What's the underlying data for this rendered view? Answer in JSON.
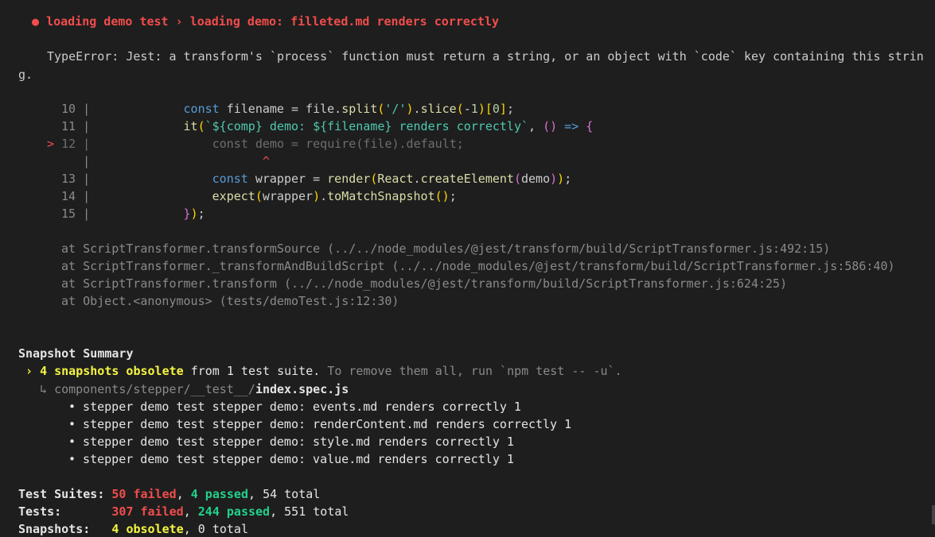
{
  "fail_header": {
    "bullet": "●",
    "suite": "loading demo test",
    "sep": "›",
    "name": "loading demo: filleted.md renders correctly"
  },
  "error": {
    "line1": "TypeError: Jest: a transform's `process` function must return a string, or an object with `code` key containing this strin",
    "line2": "g."
  },
  "code": {
    "l10_num": "10",
    "l11_num": "11",
    "l12_num": "12",
    "l13_num": "13",
    "l14_num": "14",
    "l15_num": "15",
    "pipe": "|",
    "arrow": ">",
    "caret": "^"
  },
  "stack": [
    "at ScriptTransformer.transformSource (../../node_modules/@jest/transform/build/ScriptTransformer.js:492:15)",
    "at ScriptTransformer._transformAndBuildScript (../../node_modules/@jest/transform/build/ScriptTransformer.js:586:40)",
    "at ScriptTransformer.transform (../../node_modules/@jest/transform/build/ScriptTransformer.js:624:25)",
    "at Object.<anonymous> (tests/demoTest.js:12:30)"
  ],
  "snapshot_summary": {
    "title": "Snapshot Summary",
    "arrow": "›",
    "obsolete": "4 snapshots obsolete",
    "from_text": " from 1 test suite. ",
    "hint": "To remove them all, run `npm test -- -u`.",
    "file_arrow": "↳",
    "file_dir": "components/stepper/__test__/",
    "file_name": "index.spec.js",
    "items": [
      "• stepper demo test stepper demo: events.md renders correctly 1",
      "• stepper demo test stepper demo: renderContent.md renders correctly 1",
      "• stepper demo test stepper demo: style.md renders correctly 1",
      "• stepper demo test stepper demo: value.md renders correctly 1"
    ]
  },
  "results": {
    "suites_label": "Test Suites:",
    "suites_failed": "50 failed",
    "suites_passed": "4 passed",
    "suites_total": "54 total",
    "tests_label": "Tests:",
    "tests_failed": "307 failed",
    "tests_passed": "244 passed",
    "tests_total": "551 total",
    "snaps_label": "Snapshots:",
    "snaps_obsolete": "4 obsolete",
    "snaps_total": "0 total",
    "comma": ", "
  },
  "colors": {
    "background": "#1e1e1e",
    "fail": "#f14c4c",
    "pass": "#23d18b",
    "warn": "#f5f543"
  }
}
